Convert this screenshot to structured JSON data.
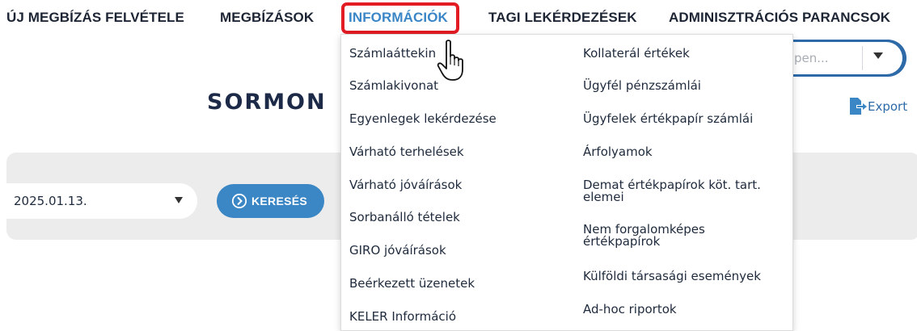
{
  "nav": {
    "items": [
      {
        "label": "ÚJ MEGBÍZÁS FELVÉTELE"
      },
      {
        "label": "MEGBÍZÁSOK"
      },
      {
        "label": "INFORMÁCIÓK"
      },
      {
        "label": "TAGI LEKÉRDEZÉSEK"
      },
      {
        "label": "ADMINISZTRÁCIÓS PARANCSOK"
      }
    ],
    "active_color": "#3a86c6",
    "highlight_color": "#e31b23"
  },
  "page": {
    "title": "SORMON"
  },
  "top_select": {
    "placeholder": "pen..."
  },
  "export": {
    "label": "Export",
    "icon": "file-export-icon"
  },
  "filter": {
    "date_value": "2025.01.13.",
    "search_label": "KERESÉS",
    "search_icon": "circle-arrow-right-icon"
  },
  "dropdown": {
    "left_column": [
      {
        "label": "Számlaáttekin"
      },
      {
        "label": "Számlakivonat"
      },
      {
        "label": "Egyenlegek lekérdezése"
      },
      {
        "label": "Várható terhelések"
      },
      {
        "label": "Várható jóváírások"
      },
      {
        "label": "Sorbanálló tételek"
      },
      {
        "label": "GIRO jóváírások"
      },
      {
        "label": "Beérkezett üzenetek"
      },
      {
        "label": "KELER Információ"
      }
    ],
    "right_column": [
      {
        "label": "Kollaterál értékek"
      },
      {
        "label": "Ügyfél pénzszámlái"
      },
      {
        "label": "Ügyfelek értékpapír számlái"
      },
      {
        "label": "Árfolyamok"
      },
      {
        "label": "Demat értékpapírok köt. tart. elemei"
      },
      {
        "label": "Nem forgalomképes értékpapírok"
      },
      {
        "label": "Külföldi társasági események"
      },
      {
        "label": "Ad-hoc riportok"
      }
    ]
  },
  "colors": {
    "accent": "#3b86c4",
    "nav_text": "#1d2535",
    "panel_bg": "#ececec"
  }
}
